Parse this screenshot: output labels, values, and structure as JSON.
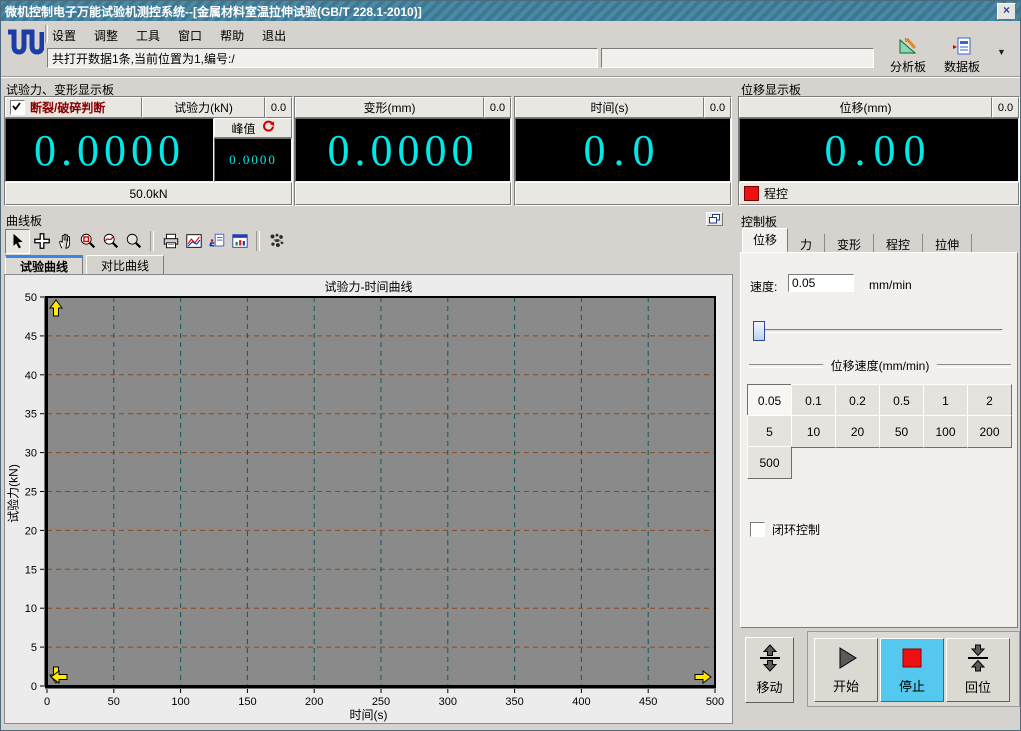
{
  "window": {
    "title": "微机控制电子万能试验机测控系统--[金属材料室温拉伸试验(GB/T 228.1-2010)]",
    "close_glyph": "×"
  },
  "menu": {
    "items": [
      "设置",
      "调整",
      "工具",
      "窗口",
      "帮助",
      "退出"
    ]
  },
  "toolbar": {
    "status_text": "共打开数据1条,当前位置为1,编号:/",
    "secondary_field": "",
    "analysis_label": "分析板",
    "data_label": "数据板",
    "dropdown_glyph": "▼"
  },
  "force_panel": {
    "title": "试验力、变形显示板",
    "break_judge_label": "断裂/破碎判断",
    "break_judge_checked": true,
    "displays": {
      "force": {
        "header": "试验力(kN)",
        "corner": "0.0",
        "value": "0.0000",
        "peak_label": "峰值",
        "peak_value": "0.0000",
        "range": "50.0kN"
      },
      "deform": {
        "header": "变形(mm)",
        "corner": "0.0",
        "value": "0.0000"
      },
      "time": {
        "header": "时间(s)",
        "corner": "0.0",
        "value": "0.0"
      }
    }
  },
  "displacement_panel": {
    "title": "位移显示板",
    "header": "位移(mm)",
    "corner": "0.0",
    "value": "0.00",
    "program_label": "程控"
  },
  "curve_panel": {
    "title": "曲线板",
    "tabs": [
      "试验曲线",
      "对比曲线"
    ],
    "active_tab": 0,
    "toolbar_icons": [
      "select-cursor-icon",
      "move-cross-icon",
      "pan-hand-icon",
      "zoom-box-icon",
      "zoom-curve-icon",
      "magnifier-icon",
      "print-icon",
      "curve-settings-icon",
      "copy-curve-icon",
      "data-window-icon",
      "marker-pattern-icon"
    ]
  },
  "chart_data": {
    "type": "line",
    "title": "试验力-时间曲线",
    "xlabel": "时间(s)",
    "ylabel": "试验力(kN)",
    "xlim": [
      0,
      500
    ],
    "ylim": [
      0,
      50
    ],
    "xticks": [
      0,
      50,
      100,
      150,
      200,
      250,
      300,
      350,
      400,
      450,
      500
    ],
    "yticks": [
      0,
      5,
      10,
      15,
      20,
      25,
      30,
      35,
      40,
      45,
      50
    ],
    "grid": true,
    "series": [],
    "plot_bg": "#8a8a8a",
    "hgrid_color": "#8a4a1c",
    "vgrid_color": "#0d5b5b",
    "arrow_color": "#ffe900"
  },
  "control_panel": {
    "title": "控制板",
    "tabs": [
      "位移",
      "力",
      "变形",
      "程控",
      "拉伸"
    ],
    "active_tab": 0,
    "speed_label": "速度:",
    "speed_value": "0.05",
    "speed_unit": "mm/min",
    "speed_group_label": "位移速度(mm/min)",
    "speed_buttons": [
      "0.05",
      "0.1",
      "0.2",
      "0.5",
      "1",
      "2",
      "5",
      "10",
      "20",
      "50",
      "100",
      "200",
      "500"
    ],
    "selected_speed": "0.05",
    "closed_loop_label": "闭环控制",
    "closed_loop_checked": false,
    "buttons": {
      "move": "移动",
      "start": "开始",
      "stop": "停止",
      "return": "回位"
    }
  },
  "colors": {
    "titlebar": "#4184a1",
    "display_text": "#00e8e8",
    "display_bg": "#000000",
    "break_judge_text": "#8b0000",
    "stop_button_bg": "#55c8f0",
    "stop_square": "#ee1111",
    "program_square": "#ee1111",
    "active_tab_stripe": "#3a86e8"
  }
}
